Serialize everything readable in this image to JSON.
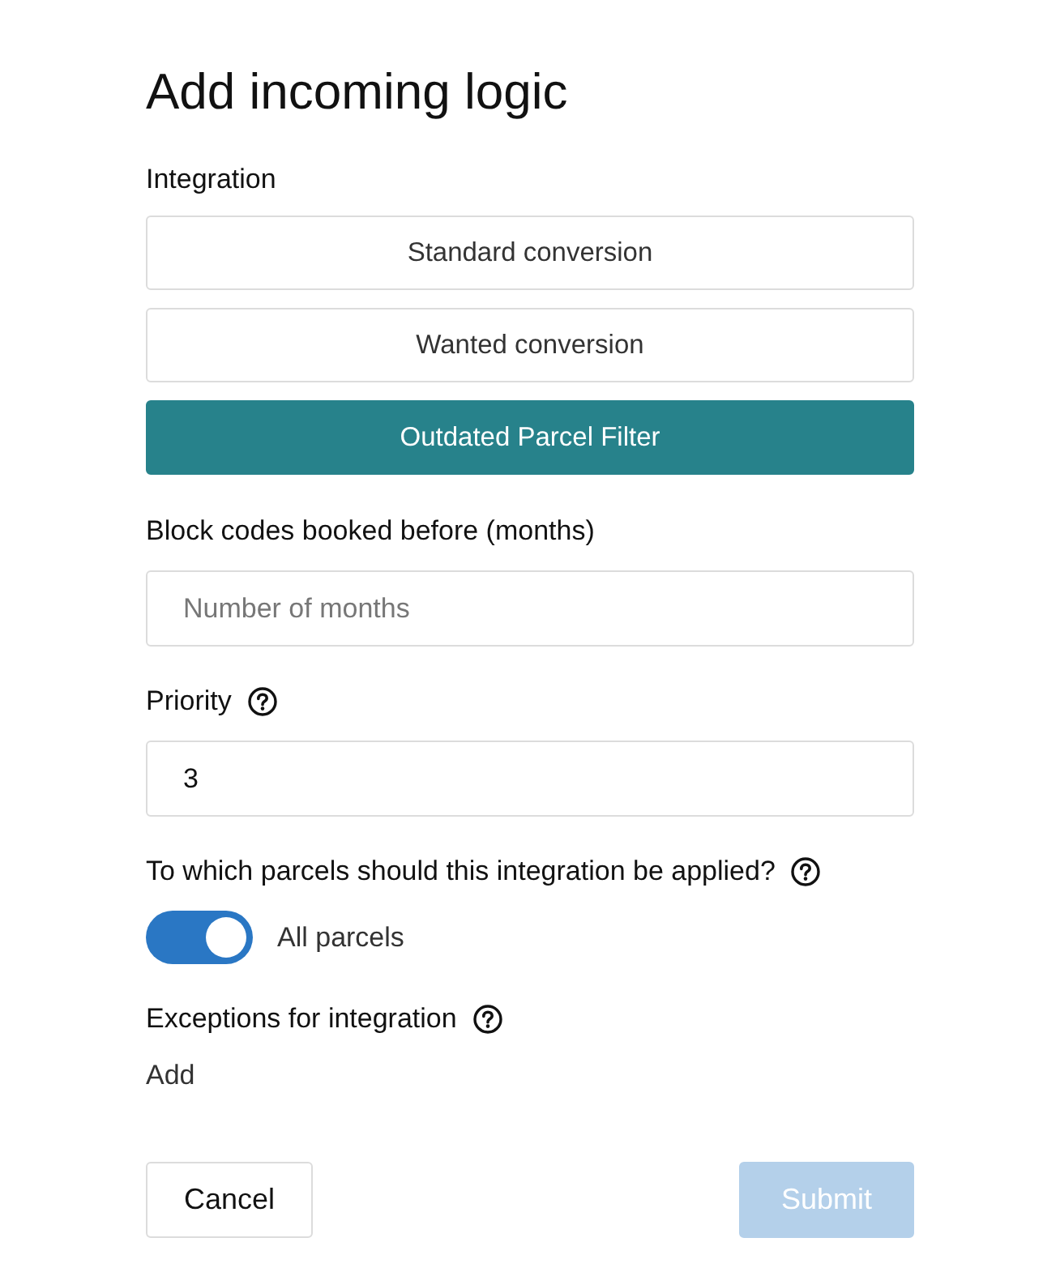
{
  "dialog": {
    "title": "Add incoming logic"
  },
  "integration": {
    "label": "Integration",
    "options": [
      {
        "label": "Standard conversion",
        "selected": false
      },
      {
        "label": "Wanted conversion",
        "selected": false
      },
      {
        "label": "Outdated Parcel Filter",
        "selected": true
      }
    ]
  },
  "fields": [
    {
      "label": "Block codes booked before (months)",
      "help": false,
      "placeholder": "Number of months"
    },
    {
      "label": "Priority",
      "help": true,
      "value": "3"
    }
  ],
  "apply_to": {
    "label": "To which parcels should this integration be applied?",
    "help": true,
    "toggle": {
      "on": true,
      "label": "All parcels"
    }
  },
  "exceptions": {
    "label": "Exceptions for integration",
    "help": true,
    "add_link": "Add"
  },
  "buttons": [
    {
      "kind": "secondary",
      "label": "Cancel",
      "disabled": false
    },
    {
      "kind": "primary",
      "label": "Submit",
      "disabled": true
    }
  ]
}
